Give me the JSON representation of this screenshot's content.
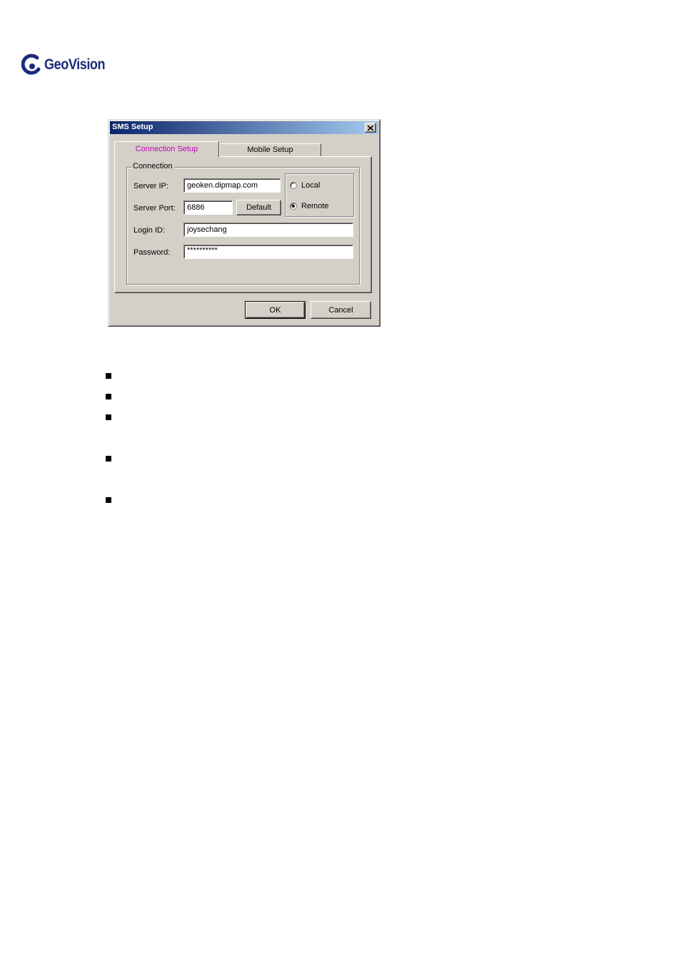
{
  "brand": {
    "logo_text": "GeoVision"
  },
  "dialog": {
    "title": "SMS Setup",
    "tabs": [
      {
        "label": "Connection Setup",
        "active": true
      },
      {
        "label": "Mobile Setup",
        "active": false
      }
    ],
    "connection": {
      "legend": "Connection",
      "server_ip_label": "Server IP:",
      "server_ip_value": "geoken.dipmap.com",
      "server_port_label": "Server Port:",
      "server_port_value": "6886",
      "default_button": "Default",
      "login_id_label": "Login ID:",
      "login_id_value": "joysechang",
      "password_label": "Password:",
      "password_value": "**********",
      "mode_options": [
        {
          "label": "Local",
          "checked": false
        },
        {
          "label": "Remote",
          "checked": true
        }
      ]
    },
    "ok_button": "OK",
    "cancel_button": "Cancel"
  },
  "colors": {
    "titlebar_start": "#0a246a",
    "titlebar_end": "#a6caf0",
    "active_tab_text": "#c000c0",
    "dialog_face": "#d4d0c8",
    "logo_blue": "#1c2b7a"
  },
  "icons": [
    "geovision-logo-icon",
    "close-icon",
    "bullet-icon"
  ]
}
